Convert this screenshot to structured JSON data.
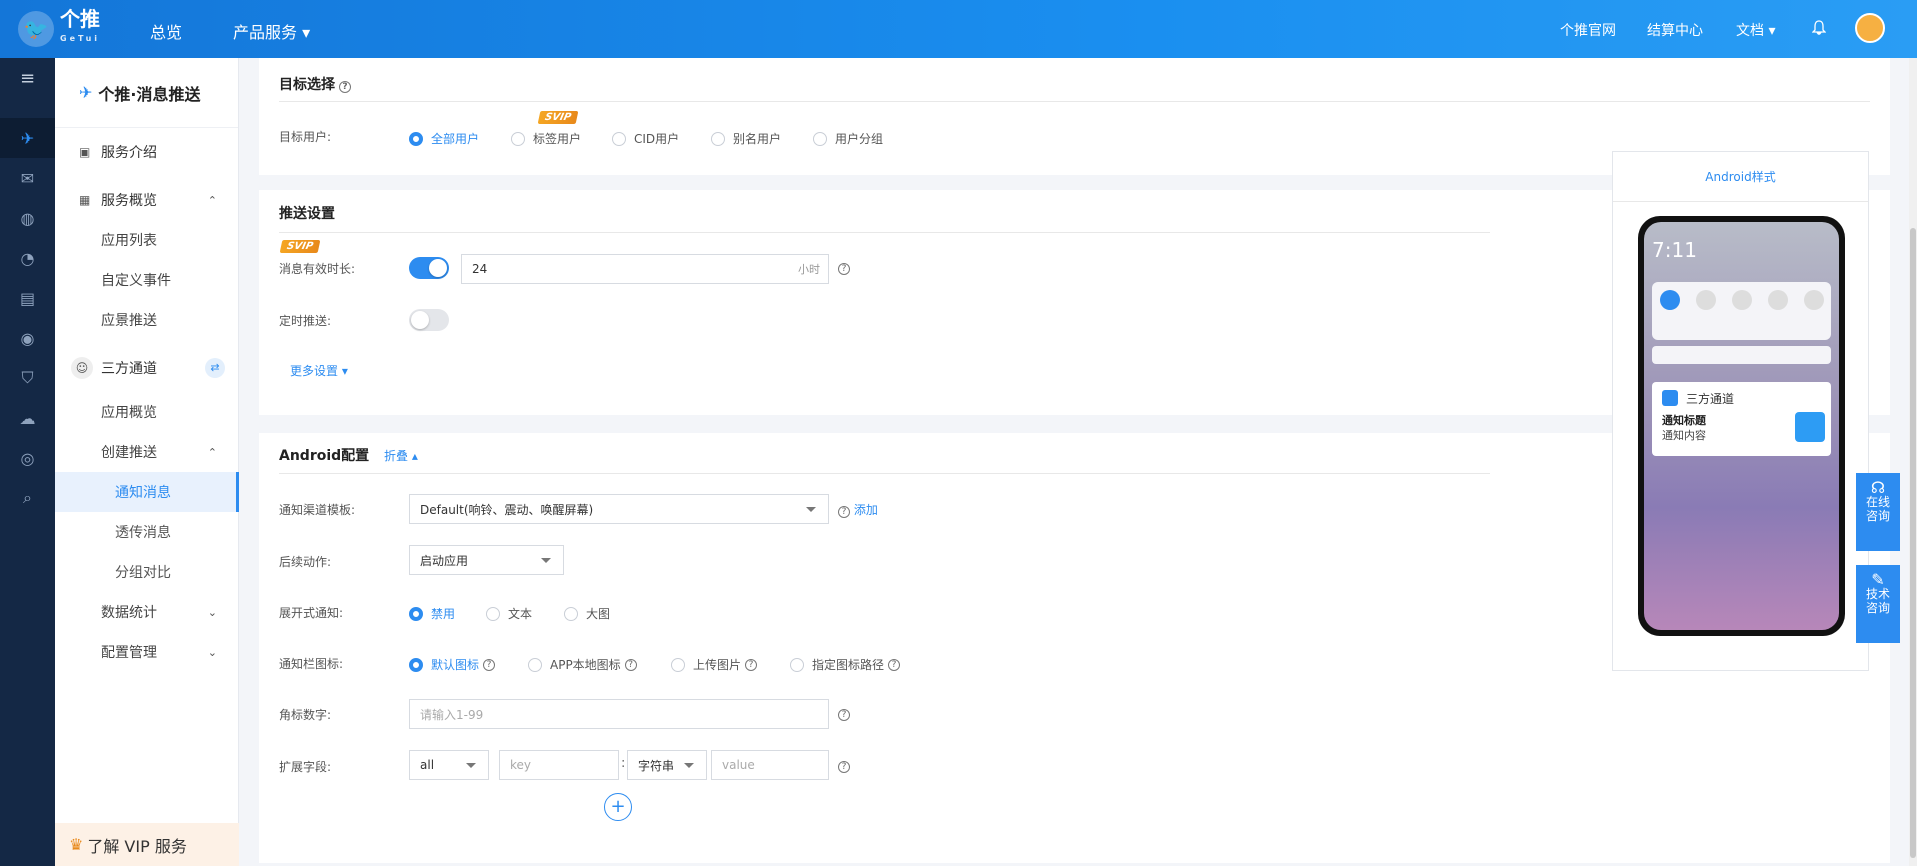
{
  "topbar": {
    "logo_text": "个推",
    "logo_sub": "GeTui",
    "nav": [
      "总览",
      "产品服务 ▾"
    ],
    "right": [
      "个推官网",
      "结算中心",
      "文档 ▾"
    ],
    "icons": [
      "bell-icon",
      "avatar"
    ]
  },
  "iconbar": [
    "push-icon",
    "mail-icon",
    "globe-icon",
    "chart-icon",
    "book-icon",
    "eye-icon",
    "shield-icon",
    "cloud-icon",
    "user-icon",
    "search-icon"
  ],
  "sidebar": {
    "title": "个推·消息推送",
    "items": [
      {
        "label": "服务介绍"
      },
      {
        "label": "服务概览",
        "arrow": "^"
      },
      {
        "label": "应用列表"
      },
      {
        "label": "自定义事件"
      },
      {
        "label": "应景推送"
      },
      {
        "label": "三方通道",
        "arrow": "⇄"
      },
      {
        "label": "应用概览"
      },
      {
        "label": "创建推送",
        "arrow": "^"
      },
      {
        "label": "通知消息"
      },
      {
        "label": "透传消息"
      },
      {
        "label": "分组对比"
      },
      {
        "label": "数据统计",
        "arrow": "v"
      },
      {
        "label": "配置管理",
        "arrow": "v"
      }
    ],
    "vip_label": "了解 VIP 服务"
  },
  "target": {
    "title": "目标选择",
    "label": "目标用户:",
    "options": [
      "全部用户",
      "标签用户",
      "CID用户",
      "别名用户",
      "用户分组"
    ],
    "svip": "SVIP"
  },
  "push_settings": {
    "title": "推送设置",
    "svip": "SVIP",
    "validity_label": "消息有效时长:",
    "validity_value": "24",
    "validity_unit": "小时",
    "timed_label": "定时推送:",
    "more": "更多设置 ▾"
  },
  "android": {
    "title": "Android配置",
    "collapse": "折叠 ▴",
    "channel_label": "通知渠道模板:",
    "channel_value": "Default(响铃、震动、唤醒屏幕)",
    "add": "添加",
    "action_label": "后续动作:",
    "action_value": "启动应用",
    "expand_label": "展开式通知:",
    "expand_options": [
      "禁用",
      "文本",
      "大图"
    ],
    "icon_label": "通知栏图标:",
    "icon_options": [
      "默认图标",
      "APP本地图标",
      "上传图片",
      "指定图标路径"
    ],
    "badge_label": "角标数字:",
    "badge_placeholder": "请输入1-99",
    "ext_label": "扩展字段:",
    "ext_scope": "all",
    "ext_key_placeholder": "key",
    "ext_type": "字符串",
    "ext_value_placeholder": "value",
    "plus": "+"
  },
  "preview": {
    "title": "Android样式",
    "time": "7:11",
    "app_name": "三方通道",
    "notif_title": "通知标题",
    "notif_content": "通知内容"
  },
  "float": {
    "online": "在线\n咨询",
    "tech": "技术\n咨询"
  },
  "colors": {
    "accent": "#2d8cf0",
    "topbar": "#1a8ff0",
    "sidebar_dark": "#142845",
    "svip": "#f5a623"
  }
}
